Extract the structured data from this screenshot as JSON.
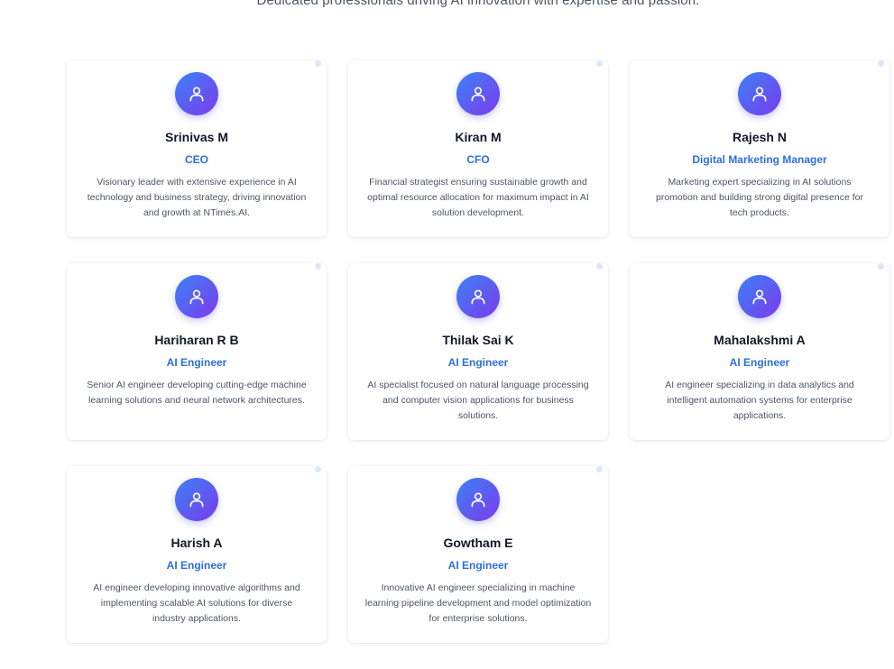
{
  "header": {
    "subtitle": "Dedicated professionals driving AI innovation with expertise and passion."
  },
  "icons": {
    "avatar": "user-icon"
  },
  "colors": {
    "accent": "#2f6fd8",
    "avatar_gradient_start": "#3b82f6",
    "avatar_gradient_end": "#7c3aed"
  },
  "team": [
    {
      "name": "Srinivas M",
      "role": "CEO",
      "bio": "Visionary leader with extensive experience in AI technology and business strategy, driving innovation and growth at NTimes.AI."
    },
    {
      "name": "Kiran M",
      "role": "CFO",
      "bio": "Financial strategist ensuring sustainable growth and optimal resource allocation for maximum impact in AI solution development."
    },
    {
      "name": "Rajesh N",
      "role": "Digital Marketing Manager",
      "bio": "Marketing expert specializing in AI solutions promotion and building strong digital presence for tech products."
    },
    {
      "name": "Hariharan R B",
      "role": "AI Engineer",
      "bio": "Senior AI engineer developing cutting-edge machine learning solutions and neural network architectures."
    },
    {
      "name": "Thilak Sai K",
      "role": "AI Engineer",
      "bio": "AI specialist focused on natural language processing and computer vision applications for business solutions."
    },
    {
      "name": "Mahalakshmi A",
      "role": "AI Engineer",
      "bio": "AI engineer specializing in data analytics and intelligent automation systems for enterprise applications."
    },
    {
      "name": "Harish A",
      "role": "AI Engineer",
      "bio": "AI engineer developing innovative algorithms and implementing scalable AI solutions for diverse industry applications."
    },
    {
      "name": "Gowtham E",
      "role": "AI Engineer",
      "bio": "Innovative AI engineer specializing in machine learning pipeline development and model optimization for enterprise solutions."
    }
  ]
}
